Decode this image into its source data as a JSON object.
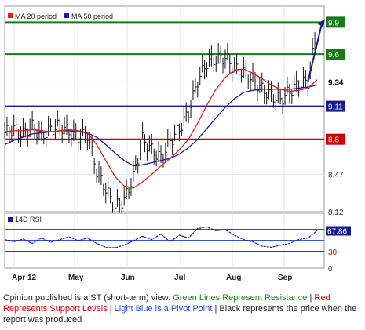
{
  "chart_data": [
    {
      "type": "line",
      "panel": "price",
      "legend": [
        {
          "name": "MA 20 period",
          "color": "#e02020"
        },
        {
          "name": "MA 50 period",
          "color": "#1a1aa0"
        }
      ],
      "legend_position": "top-left",
      "ylim": [
        8.12,
        10.05
      ],
      "yticks": [
        "8.12",
        "8.47"
      ],
      "x_ticks": [
        "Apr 12",
        "May",
        "Jun",
        "Jul",
        "Aug",
        "Sep"
      ],
      "grid": true,
      "levels": [
        {
          "label": "9.9",
          "value": 9.9,
          "color": "#1a7a1a",
          "role": "resistance"
        },
        {
          "label": "9.6",
          "value": 9.6,
          "color": "#1a7a1a",
          "role": "resistance"
        },
        {
          "label": "9.34",
          "value": 9.34,
          "color": "#000000",
          "role": "price"
        },
        {
          "label": "9.11",
          "value": 9.11,
          "color": "#1a1a8c",
          "role": "pivot"
        },
        {
          "label": "8.8",
          "value": 8.8,
          "color": "#cc0000",
          "role": "support"
        }
      ],
      "price_x": [
        0,
        5,
        10,
        15,
        20,
        25,
        30,
        35,
        40,
        45,
        50,
        55,
        60,
        65,
        70,
        75,
        80,
        85,
        90,
        95,
        100,
        105,
        110,
        115,
        120,
        125,
        130,
        135,
        140,
        145,
        150,
        155,
        160,
        165,
        170
      ],
      "price": [
        8.86,
        8.9,
        8.85,
        8.92,
        8.83,
        8.89,
        8.93,
        8.87,
        8.82,
        8.85,
        8.5,
        8.33,
        8.16,
        8.23,
        8.45,
        8.8,
        8.7,
        8.62,
        8.78,
        8.9,
        9.05,
        9.35,
        9.52,
        9.55,
        9.57,
        9.46,
        9.43,
        9.36,
        9.27,
        9.21,
        9.17,
        9.25,
        9.32,
        9.34,
        9.85
      ],
      "ma20": [
        8.87,
        8.88,
        8.88,
        8.89,
        8.88,
        8.87,
        8.88,
        8.89,
        8.88,
        8.86,
        8.75,
        8.6,
        8.45,
        8.36,
        8.34,
        8.4,
        8.47,
        8.55,
        8.62,
        8.7,
        8.8,
        8.95,
        9.12,
        9.27,
        9.38,
        9.45,
        9.46,
        9.42,
        9.37,
        9.31,
        9.27,
        9.25,
        9.26,
        9.28,
        9.36
      ],
      "ma50": [
        8.75,
        8.79,
        8.82,
        8.85,
        8.86,
        8.87,
        8.88,
        8.88,
        8.87,
        8.86,
        8.82,
        8.75,
        8.67,
        8.6,
        8.55,
        8.56,
        8.58,
        8.6,
        8.62,
        8.66,
        8.72,
        8.8,
        8.9,
        9.0,
        9.1,
        9.18,
        9.24,
        9.26,
        9.27,
        9.27,
        9.27,
        9.27,
        9.28,
        9.29,
        9.31
      ]
    },
    {
      "type": "line",
      "panel": "rsi",
      "legend": [
        {
          "name": "14D RSI",
          "color": "#1a1a8c"
        }
      ],
      "ylim": [
        0,
        100
      ],
      "yticks": [
        "0",
        "30"
      ],
      "levels": [
        {
          "label": "70",
          "value": 70,
          "color": "#1a7a1a"
        },
        {
          "label": "50",
          "value": 50,
          "color": "#3355cc"
        },
        {
          "label": "30",
          "value": 30,
          "color": "#cc0000"
        }
      ],
      "current_label": "67.86",
      "current": 67.86,
      "x": [
        0,
        5,
        10,
        15,
        20,
        25,
        30,
        35,
        40,
        45,
        50,
        55,
        60,
        65,
        70,
        75,
        80,
        85,
        90,
        95,
        100,
        105,
        110,
        115,
        120,
        125,
        130,
        135,
        140,
        145,
        150,
        155,
        160,
        165,
        170
      ],
      "values": [
        52,
        48,
        53,
        45,
        55,
        47,
        52,
        57,
        50,
        55,
        45,
        38,
        37,
        42,
        50,
        58,
        52,
        62,
        48,
        60,
        55,
        72,
        75,
        68,
        70,
        60,
        52,
        48,
        40,
        38,
        42,
        45,
        52,
        55,
        68
      ]
    }
  ],
  "caption": {
    "part1": "Opinion published is a ST (short-term) view. ",
    "green": "Green Lines Represent Resistance",
    "sep1": " | ",
    "red": "Red Represents Support Levels",
    "sep2": " | ",
    "blue": "Light Blue is a Pivot Point",
    "sep3": " | ",
    "black": " Black represents the price when the report was produced"
  },
  "colors": {
    "green": "#1a7a1a",
    "red": "#cc0000",
    "blue": "#1a1a8c",
    "light_blue": "#3355cc",
    "grid": "#e6e6e6"
  }
}
